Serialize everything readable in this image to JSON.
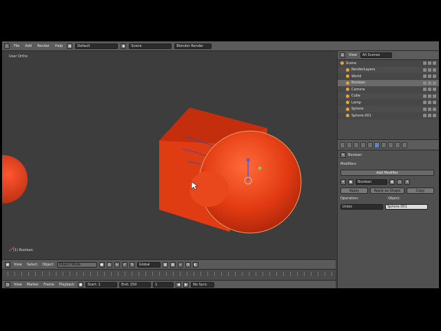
{
  "topbar": {
    "menus": [
      "File",
      "Add",
      "Render",
      "Help"
    ],
    "layout_value": "Default",
    "scene_value": "Scene",
    "engine_value": "Blender Render"
  },
  "viewport": {
    "label": "User Ortho",
    "object_label": "(1) Boolean",
    "colors": {
      "mesh": "#e23a12",
      "background": "#3d3d3d"
    }
  },
  "viewport_header": {
    "menus": [
      "View",
      "Select",
      "Object"
    ],
    "mode_value": "Object Mode",
    "pivot_value": "Global"
  },
  "timeline_header": {
    "menus": [
      "View",
      "Marker",
      "Frame",
      "Playback"
    ],
    "start_label": "Start: 1",
    "end_label": "End: 250",
    "current_label": "1",
    "sync_label": "No Sync"
  },
  "outliner": {
    "view_label": "View",
    "search_value": "All Scenes",
    "rows": [
      {
        "label": "Scene",
        "indent": 0
      },
      {
        "label": "RenderLayers",
        "indent": 1
      },
      {
        "label": "World",
        "indent": 1
      },
      {
        "label": "Boolean",
        "indent": 1,
        "selected": true
      },
      {
        "label": "Camera",
        "indent": 1
      },
      {
        "label": "Cube",
        "indent": 1
      },
      {
        "label": "Lamp",
        "indent": 1
      },
      {
        "label": "Sphere",
        "indent": 1
      },
      {
        "label": "Sphere.001",
        "indent": 1
      }
    ]
  },
  "properties": {
    "object_name": "Boolean",
    "panel_title": "Modifiers",
    "add_modifier_label": "Add Modifier",
    "modifier_name": "Boolean",
    "apply_label": "Apply",
    "apply_as_shape_label": "Apply as Shape",
    "copy_label": "Copy",
    "operation_label": "Operation:",
    "object_label": "Object:",
    "operation_value": "Union",
    "object_value": "Sphere.001"
  }
}
